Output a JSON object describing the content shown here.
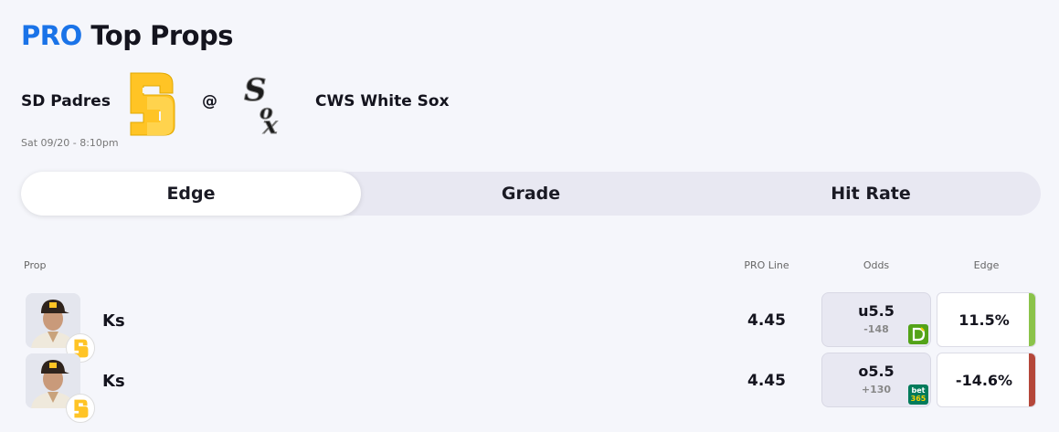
{
  "header": {
    "title_pro": "PRO",
    "title_rest": "Top Props"
  },
  "game": {
    "away_team": "SD Padres",
    "separator": "@",
    "home_team": "CWS White Sox",
    "datetime": "Sat 09/20 - 8:10pm",
    "away_logo_icon": "padres-logo-icon",
    "home_logo_icon": "white-sox-logo-icon"
  },
  "tabs": [
    {
      "label": "Edge",
      "active": true
    },
    {
      "label": "Grade",
      "active": false
    },
    {
      "label": "Hit Rate",
      "active": false
    }
  ],
  "table": {
    "headers": {
      "prop": "Prop",
      "pro_line": "PRO Line",
      "odds": "Odds",
      "edge": "Edge"
    },
    "rows": [
      {
        "prop": "Ks",
        "pro_line": "4.45",
        "odds_line": "u5.5",
        "odds_price": "-148",
        "book": "draftkings",
        "edge": "11.5%",
        "edge_color": "#8bc34a"
      },
      {
        "prop": "Ks",
        "pro_line": "4.45",
        "odds_line": "o5.5",
        "odds_price": "+130",
        "book": "bet365",
        "book_text_1": "bet",
        "book_text_2": "365",
        "edge": "-14.6%",
        "edge_color": "#b5473a"
      }
    ]
  },
  "colors": {
    "accent": "#1a73e8",
    "padres_gold": "#FFC425",
    "padres_brown": "#2F241D",
    "draftkings_green": "#53a318",
    "bet365_green": "#027b5b"
  }
}
